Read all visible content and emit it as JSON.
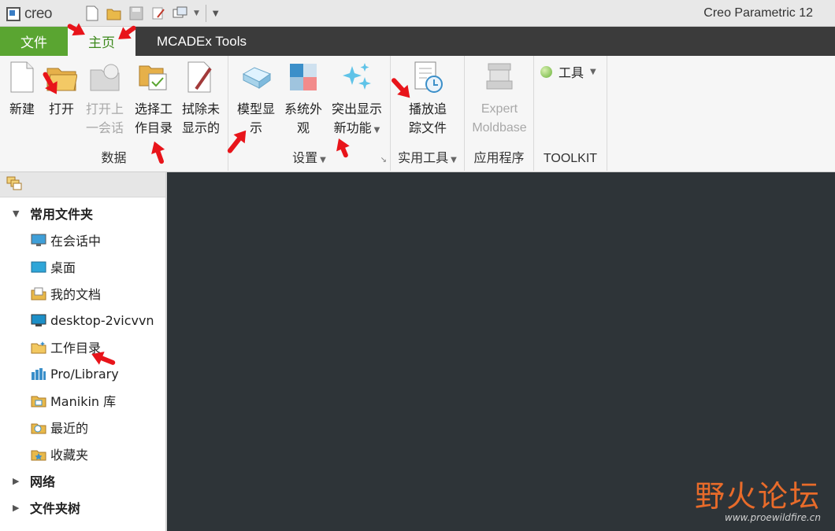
{
  "app": {
    "logo_text": "creo",
    "title": "Creo Parametric 12"
  },
  "tabs": {
    "file": "文件",
    "home": "主页",
    "mcadex": "MCADEx Tools"
  },
  "ribbon": {
    "data_group": {
      "label": "数据",
      "new": "新建",
      "open": "打开",
      "open_last_1": "打开上",
      "open_last_2": "一会话",
      "select_wd_1": "选择工",
      "select_wd_2": "作目录",
      "erase_1": "拭除未",
      "erase_2": "显示的"
    },
    "settings_group": {
      "label": "设置",
      "model_display_1": "模型显",
      "model_display_2": "示",
      "system_appearance_1": "系统外",
      "system_appearance_2": "观",
      "highlight_1": "突出显示",
      "highlight_2": "新功能"
    },
    "utilities_group": {
      "label": "实用工具",
      "play_trail_1": "播放追",
      "play_trail_2": "踪文件"
    },
    "apps_group": {
      "label": "应用程序",
      "expert_1": "Expert",
      "expert_2": "Moldbase"
    },
    "toolkit_group": {
      "label": "TOOLKIT",
      "tools": "工具"
    }
  },
  "sidebar": {
    "common_folders": "常用文件夹",
    "items": [
      {
        "label": "在会话中",
        "icon": "monitor-icon"
      },
      {
        "label": "桌面",
        "icon": "desktop-icon"
      },
      {
        "label": "我的文档",
        "icon": "documents-icon"
      },
      {
        "label": "desktop-2vicvvn",
        "icon": "computer-icon"
      },
      {
        "label": "工作目录",
        "icon": "working-folder-icon"
      },
      {
        "label": "Pro/Library",
        "icon": "library-icon"
      },
      {
        "label": "Manikin 库",
        "icon": "manikin-library-icon"
      },
      {
        "label": "最近的",
        "icon": "recent-icon"
      },
      {
        "label": "收藏夹",
        "icon": "favorites-icon"
      }
    ],
    "network": "网络",
    "folder_tree": "文件夹树"
  },
  "watermark": {
    "main": "野火论坛",
    "url": "www.proewildfire.cn"
  },
  "colors": {
    "file_tab": "#5aa531",
    "tab_bar": "#3b3b3b",
    "graphics_bg": "#2e3438",
    "annotation_arrow": "#e8141a",
    "watermark": "#e86b2a"
  }
}
